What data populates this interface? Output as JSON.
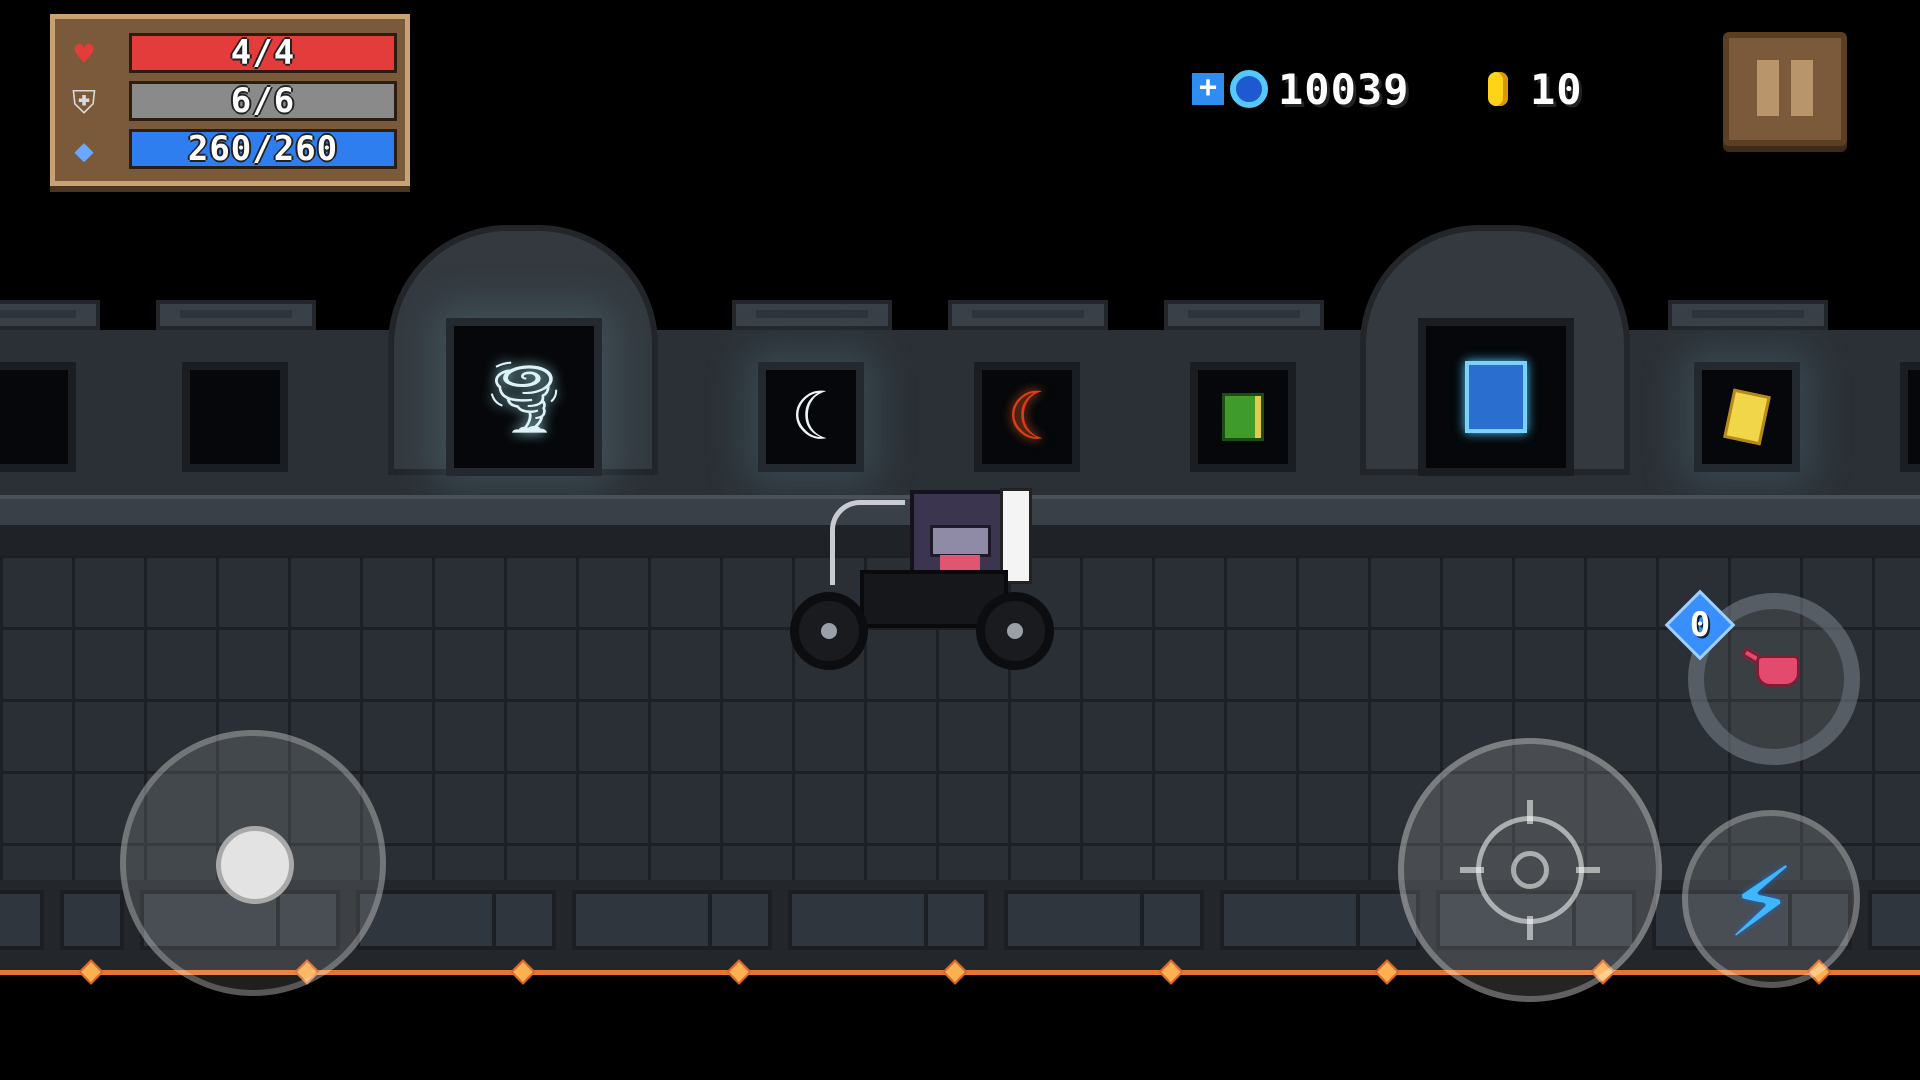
{
  "hud": {
    "health": {
      "text": "4/4",
      "fraction": 1.0,
      "color": "#e43b3b",
      "icon": "heart-icon"
    },
    "armor": {
      "text": "6/6",
      "fraction": 1.0,
      "color": "#8a8a8a",
      "icon": "shield-icon"
    },
    "energy": {
      "text": "260/260",
      "fraction": 1.0,
      "color": "#2f7ef0",
      "icon": "diamond-icon"
    },
    "gems": {
      "value": "10039",
      "icon": "gem-icon"
    },
    "coins": {
      "value": "10",
      "icon": "coin-icon"
    }
  },
  "pause": {
    "icon": "pause-icon"
  },
  "controls": {
    "move": {
      "icon": "joystick"
    },
    "attack": {
      "icon": "crosshair-icon"
    },
    "skill": {
      "icon": "lightning-icon"
    },
    "swap_weapon": {
      "icon": "watering-can-icon",
      "energy_cost": "0"
    }
  },
  "wall_items": [
    {
      "name": "empty"
    },
    {
      "name": "empty"
    },
    {
      "name": "tornado",
      "glyph": "🌪"
    },
    {
      "name": "white-crescent-blade",
      "glyph": "☾"
    },
    {
      "name": "red-crescent-blade",
      "glyph": "☾"
    },
    {
      "name": "green-book"
    },
    {
      "name": "blue-spellbook"
    },
    {
      "name": "yellow-scroll"
    }
  ]
}
